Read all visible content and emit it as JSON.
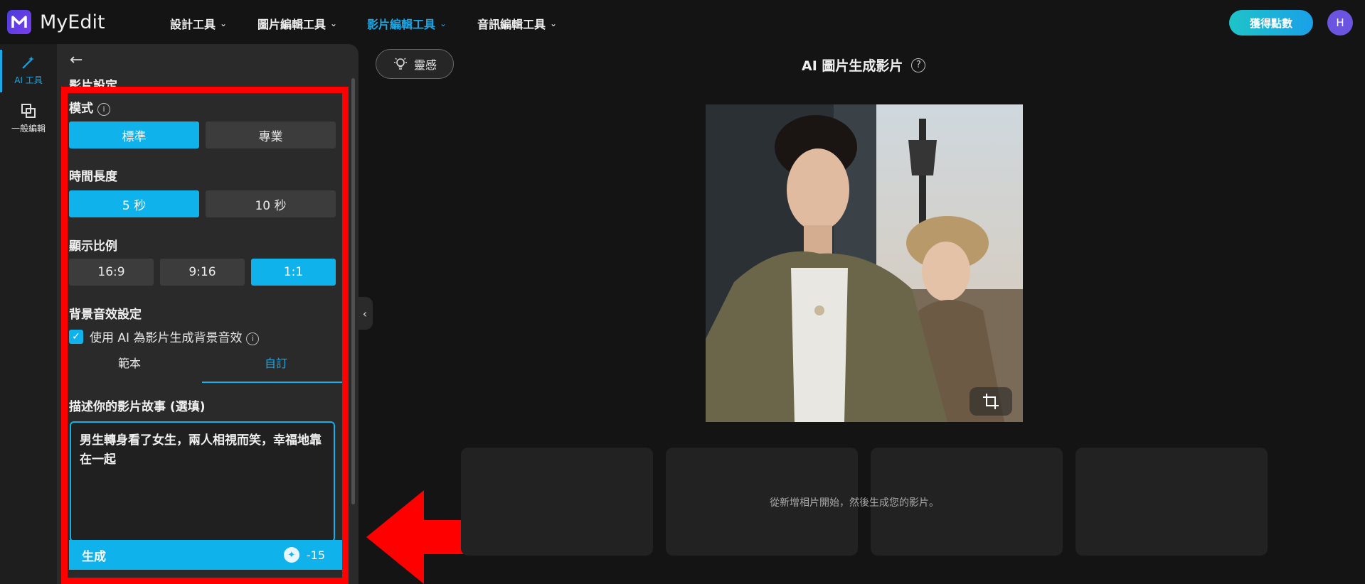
{
  "app": {
    "logo_text": "MyEdit"
  },
  "nav": [
    {
      "label": "設計工具",
      "active": false
    },
    {
      "label": "圖片編輯工具",
      "active": false
    },
    {
      "label": "影片編輯工具",
      "active": true
    },
    {
      "label": "音訊編輯工具",
      "active": false
    }
  ],
  "header": {
    "points_button": "獲得點數",
    "avatar_initial": "H"
  },
  "rail": {
    "ai_tools": "AI 工具",
    "general_edit": "一般編輯"
  },
  "panel": {
    "title": "影片設定",
    "mode_label": "模式",
    "mode_options": [
      "標準",
      "專業"
    ],
    "duration_label": "時間長度",
    "duration_options": [
      "5 秒",
      "10 秒"
    ],
    "ratio_label": "顯示比例",
    "ratio_options": [
      "16:9",
      "9:16",
      "1:1"
    ],
    "bgm_label": "背景音效設定",
    "bgm_checkbox_label": "使用 AI 為影片生成背景音效",
    "tabs": [
      "範本",
      "自訂"
    ],
    "story_label": "描述你的影片故事 (選填)",
    "story_value": "男生轉身看了女生，兩人相視而笑，幸福地靠在一起",
    "generate_label": "生成",
    "generate_cost": "-15"
  },
  "main": {
    "inspiration_button": "靈感",
    "title": "AI 圖片生成影片",
    "empty_hint": "從新增相片開始，然後生成您的影片。"
  },
  "colors": {
    "accent": "#0fb2ea",
    "annotation": "#ff0000"
  }
}
